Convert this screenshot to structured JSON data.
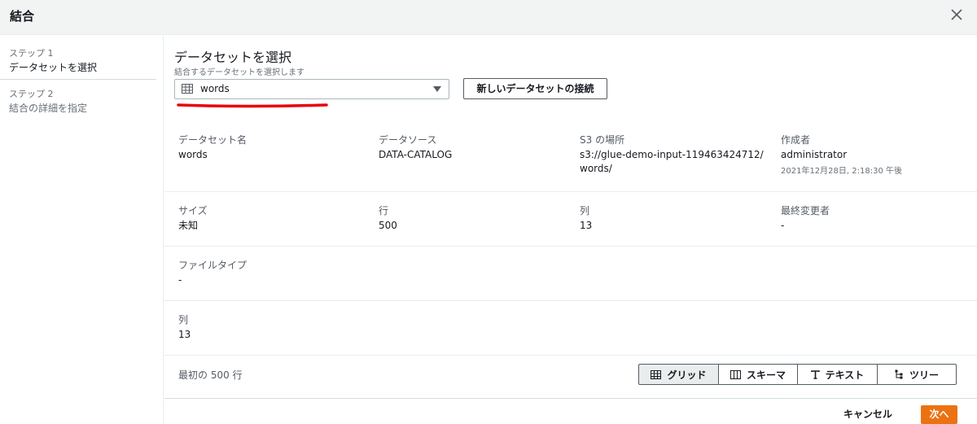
{
  "modal": {
    "title": "結合"
  },
  "sidebar": {
    "steps": [
      {
        "number": "ステップ 1",
        "name": "データセットを選択"
      },
      {
        "number": "ステップ 2",
        "name": "結合の詳細を指定"
      }
    ]
  },
  "main": {
    "heading": "データセットを選択",
    "subheading": "結合するデータセットを選択します",
    "dataset_select": {
      "value": "words"
    },
    "connect_button": "新しいデータセットの接続",
    "details": {
      "dataset_name": {
        "label": "データセット名",
        "value": "words"
      },
      "data_source": {
        "label": "データソース",
        "value": "DATA-CATALOG"
      },
      "s3_location": {
        "label": "S3 の場所",
        "value": "s3://glue-demo-input-119463424712/ words/"
      },
      "created_by": {
        "label": "作成者",
        "value": "administrator",
        "timestamp": "2021年12月28日, 2:18:30 午後"
      },
      "size": {
        "label": "サイズ",
        "value": "未知"
      },
      "rows": {
        "label": "行",
        "value": "500"
      },
      "columns": {
        "label": "列",
        "value": "13"
      },
      "last_modified_by": {
        "label": "最終変更者",
        "value": "-"
      },
      "file_type": {
        "label": "ファイルタイプ",
        "value": "-"
      },
      "columns2": {
        "label": "列",
        "value": "13"
      }
    },
    "preview": {
      "label": "最初の 500 行",
      "tabs": [
        {
          "label": "グリッド",
          "icon": "grid-icon"
        },
        {
          "label": "スキーマ",
          "icon": "schema-icon"
        },
        {
          "label": "テキスト",
          "icon": "text-icon"
        },
        {
          "label": "ツリー",
          "icon": "tree-icon"
        }
      ],
      "active_tab": "グリッド"
    }
  },
  "footer": {
    "cancel": "キャンセル",
    "next": "次へ"
  },
  "colors": {
    "primary": "#ec7211",
    "annotation": "#e8000b",
    "header_bg": "#f2f3f3"
  }
}
